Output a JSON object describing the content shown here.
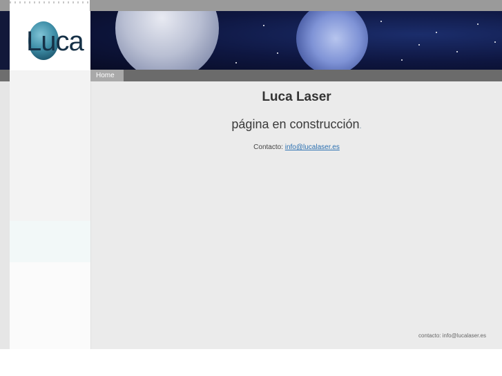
{
  "logo": {
    "text": "Luca"
  },
  "nav": {
    "items": [
      {
        "label": "Home"
      }
    ]
  },
  "main": {
    "title": "Luca Laser",
    "subtitle": "página en construcción",
    "subtitle_suffix": ".",
    "contact_label": "Contacto: ",
    "contact_email": "info@lucalaser.es"
  },
  "footer": {
    "contact_text": "contacto: info@lucalaser.es"
  },
  "colors": {
    "content_bg": "#ebebeb",
    "nav_bg": "#6b6b6b",
    "link": "#2a6fb0",
    "banner_bg": "#0e1640"
  }
}
